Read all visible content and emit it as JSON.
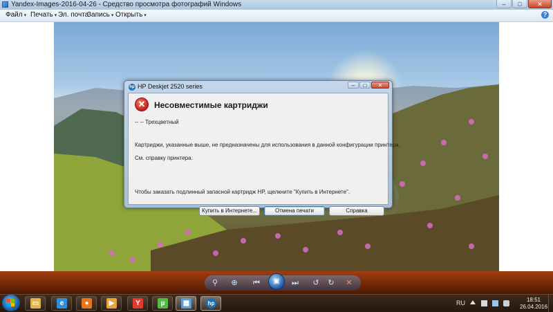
{
  "window": {
    "title": "Yandex-Images-2016-04-26 - Средство просмотра фотографий Windows",
    "minimize_glyph": "–",
    "maximize_glyph": "□",
    "close_glyph": "✕"
  },
  "menu": {
    "items": [
      {
        "label": "Файл",
        "arrow": "▾"
      },
      {
        "label": "Печать",
        "arrow": "▾"
      },
      {
        "label": "Эл. почта",
        "arrow": ""
      },
      {
        "label": "Запись",
        "arrow": "▾"
      },
      {
        "label": "Открыть",
        "arrow": "▾"
      }
    ],
    "help_glyph": "?"
  },
  "dialog": {
    "title": "HP Deskjet 2520 series",
    "hp_logo": "hp",
    "error_glyph": "✕",
    "heading": "Несовместимые картриджи",
    "line1": "-- -- Трехцветный",
    "line2": "Картриджи, указанные выше, не предназначены для использования в данной конфигурации принтера.",
    "line3": "См. справку принтера.",
    "line4": "Чтобы заказать подлинный запасной картридж HP, щелкните \"Купить в Интернете\".",
    "buttons": {
      "buy": "Купить в Интернете...",
      "cancel_print": "Отмена печати",
      "help": "Справка"
    }
  },
  "controls": {
    "zoom_glyph": "⚲",
    "fit_glyph": "⊕",
    "prev_glyph": "⏮",
    "slideshow_glyph": "▣",
    "next_glyph": "⏭",
    "rotate_ccw_glyph": "↺",
    "rotate_cw_glyph": "↻",
    "delete_glyph": "✕"
  },
  "taskbar": {
    "apps": [
      {
        "name": "explorer",
        "glyph": "▭",
        "color": "#e3b44a"
      },
      {
        "name": "internet-explorer",
        "glyph": "e",
        "color": "#2f8fdc"
      },
      {
        "name": "firefox",
        "glyph": "●",
        "color": "#e8741f"
      },
      {
        "name": "media-player",
        "glyph": "▶",
        "color": "#e9a23b"
      },
      {
        "name": "yandex-browser",
        "glyph": "Y",
        "color": "#e63a2e"
      },
      {
        "name": "utorrent",
        "glyph": "µ",
        "color": "#58b947"
      },
      {
        "name": "photo-viewer",
        "glyph": "▦",
        "color": "#5f9bd6"
      },
      {
        "name": "hp-solution-center",
        "glyph": "hp",
        "color": "#1b6fb8"
      }
    ],
    "lang": "RU",
    "time": "18:51",
    "date": "26.04.2016"
  }
}
